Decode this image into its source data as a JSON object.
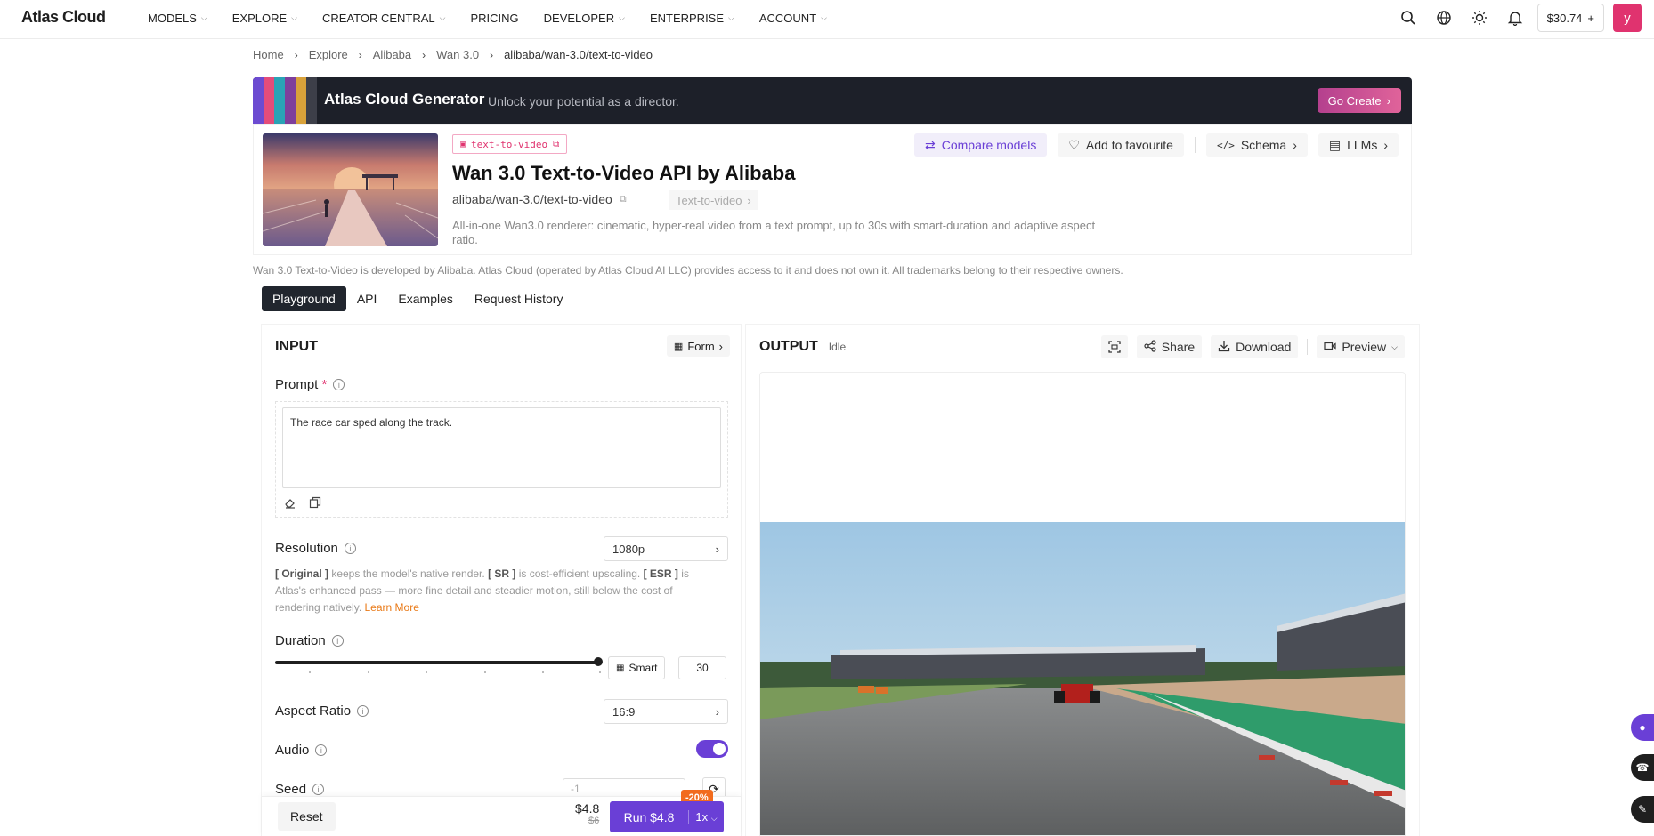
{
  "app": {
    "logo": "Atlas Cloud",
    "balance": "$30.74",
    "avatar_letter": "y"
  },
  "nav": {
    "items": [
      {
        "label": "MODELS",
        "dropdown": true
      },
      {
        "label": "EXPLORE",
        "dropdown": true
      },
      {
        "label": "CREATOR CENTRAL",
        "dropdown": true
      },
      {
        "label": "PRICING",
        "dropdown": false
      },
      {
        "label": "DEVELOPER",
        "dropdown": true
      },
      {
        "label": "ENTERPRISE",
        "dropdown": true
      },
      {
        "label": "ACCOUNT",
        "dropdown": true
      }
    ]
  },
  "breadcrumb": [
    "Home",
    "Explore",
    "Alibaba",
    "Wan 3.0",
    "alibaba/wan-3.0/text-to-video"
  ],
  "banner": {
    "title": "Atlas Cloud Generator",
    "subtitle": "Unlock your potential as a director.",
    "cta": "Go Create"
  },
  "model": {
    "tag": "text-to-video",
    "title": "Wan 3.0 Text-to-Video API by Alibaba",
    "id": "alibaba/wan-3.0/text-to-video",
    "type": "Text-to-video",
    "description": "All-in-one Wan3.0 renderer: cinematic, hyper-real video from a text prompt, up to 30s with smart-duration and adaptive aspect ratio.",
    "actions": {
      "compare": "Compare models",
      "favourite": "Add to favourite",
      "schema": "Schema",
      "llms": "LLMs"
    }
  },
  "disclaimer": "Wan 3.0 Text-to-Video is developed by Alibaba. Atlas Cloud (operated by Atlas Cloud AI LLC) provides access to it and does not own it. All trademarks belong to their respective owners.",
  "tabs": [
    "Playground",
    "API",
    "Examples",
    "Request History"
  ],
  "input": {
    "heading": "INPUT",
    "form_label": "Form",
    "prompt_label": "Prompt",
    "required_mark": "*",
    "prompt_value": "The race car sped along the track.",
    "resolution_label": "Resolution",
    "resolution_value": "1080p",
    "resolution_hint": {
      "original": "[ Original ]",
      "original_text": " keeps the model's native render. ",
      "sr": "[ SR ]",
      "sr_text": " is cost-efficient upscaling. ",
      "esr": "[ ESR ]",
      "esr_text": " is Atlas's enhanced pass — more fine detail and steadier motion, still below the cost of rendering natively. ",
      "learn_more": "Learn More"
    },
    "duration_label": "Duration",
    "duration_fraction": 1.0,
    "smart_label": "Smart",
    "duration_value": "30",
    "aspect_label": "Aspect Ratio",
    "aspect_value": "16:9",
    "audio_label": "Audio",
    "audio_on": true,
    "seed_label": "Seed",
    "seed_placeholder": "-1",
    "reset_label": "Reset",
    "price_now": "$4.8",
    "price_was": "$6",
    "run_label": "Run $4.8",
    "multiplier": "1x",
    "discount": "-20%"
  },
  "output": {
    "heading": "OUTPUT",
    "status": "Idle",
    "share": "Share",
    "download": "Download",
    "preview": "Preview"
  },
  "colors": {
    "accent": "#6a3fd6",
    "brand_pink": "#e0336f",
    "banner_bg": "#1d2029",
    "discount": "#f26b1d"
  }
}
